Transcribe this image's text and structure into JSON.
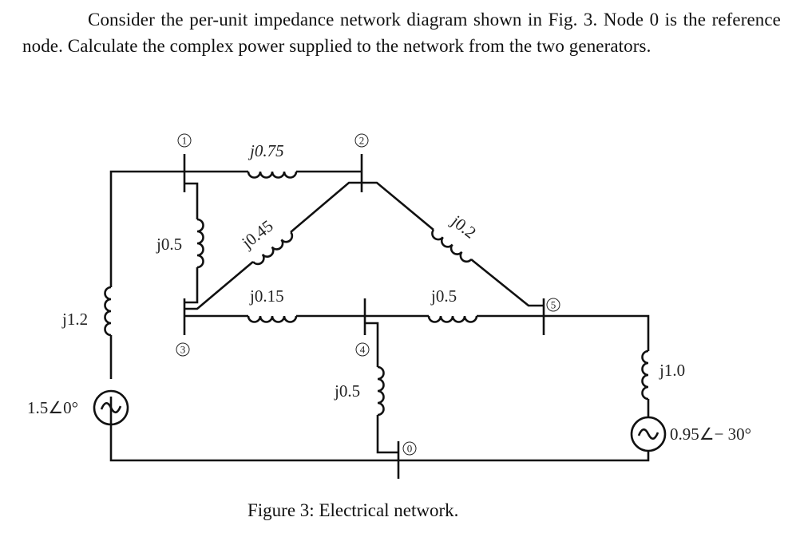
{
  "problem": {
    "text": "Consider the per-unit impedance network diagram shown in Fig. 3. Node 0 is the reference node. Calculate the complex power supplied to the network from the two generators."
  },
  "figure": {
    "caption": "Figure 3: Electrical network.",
    "nodes": [
      "1",
      "2",
      "3",
      "4",
      "5",
      "0"
    ],
    "impedances": {
      "z12": "j0.75",
      "z13": "j0.5",
      "z23": "j0.45",
      "z25": "j0.2",
      "z34": "j0.15",
      "z45": "j0.5",
      "z40": "j0.5",
      "zg1": "j1.2",
      "zg2": "j1.0"
    },
    "sources": {
      "gen1": "1.5∠0°",
      "gen2": "0.95∠− 30°"
    }
  }
}
